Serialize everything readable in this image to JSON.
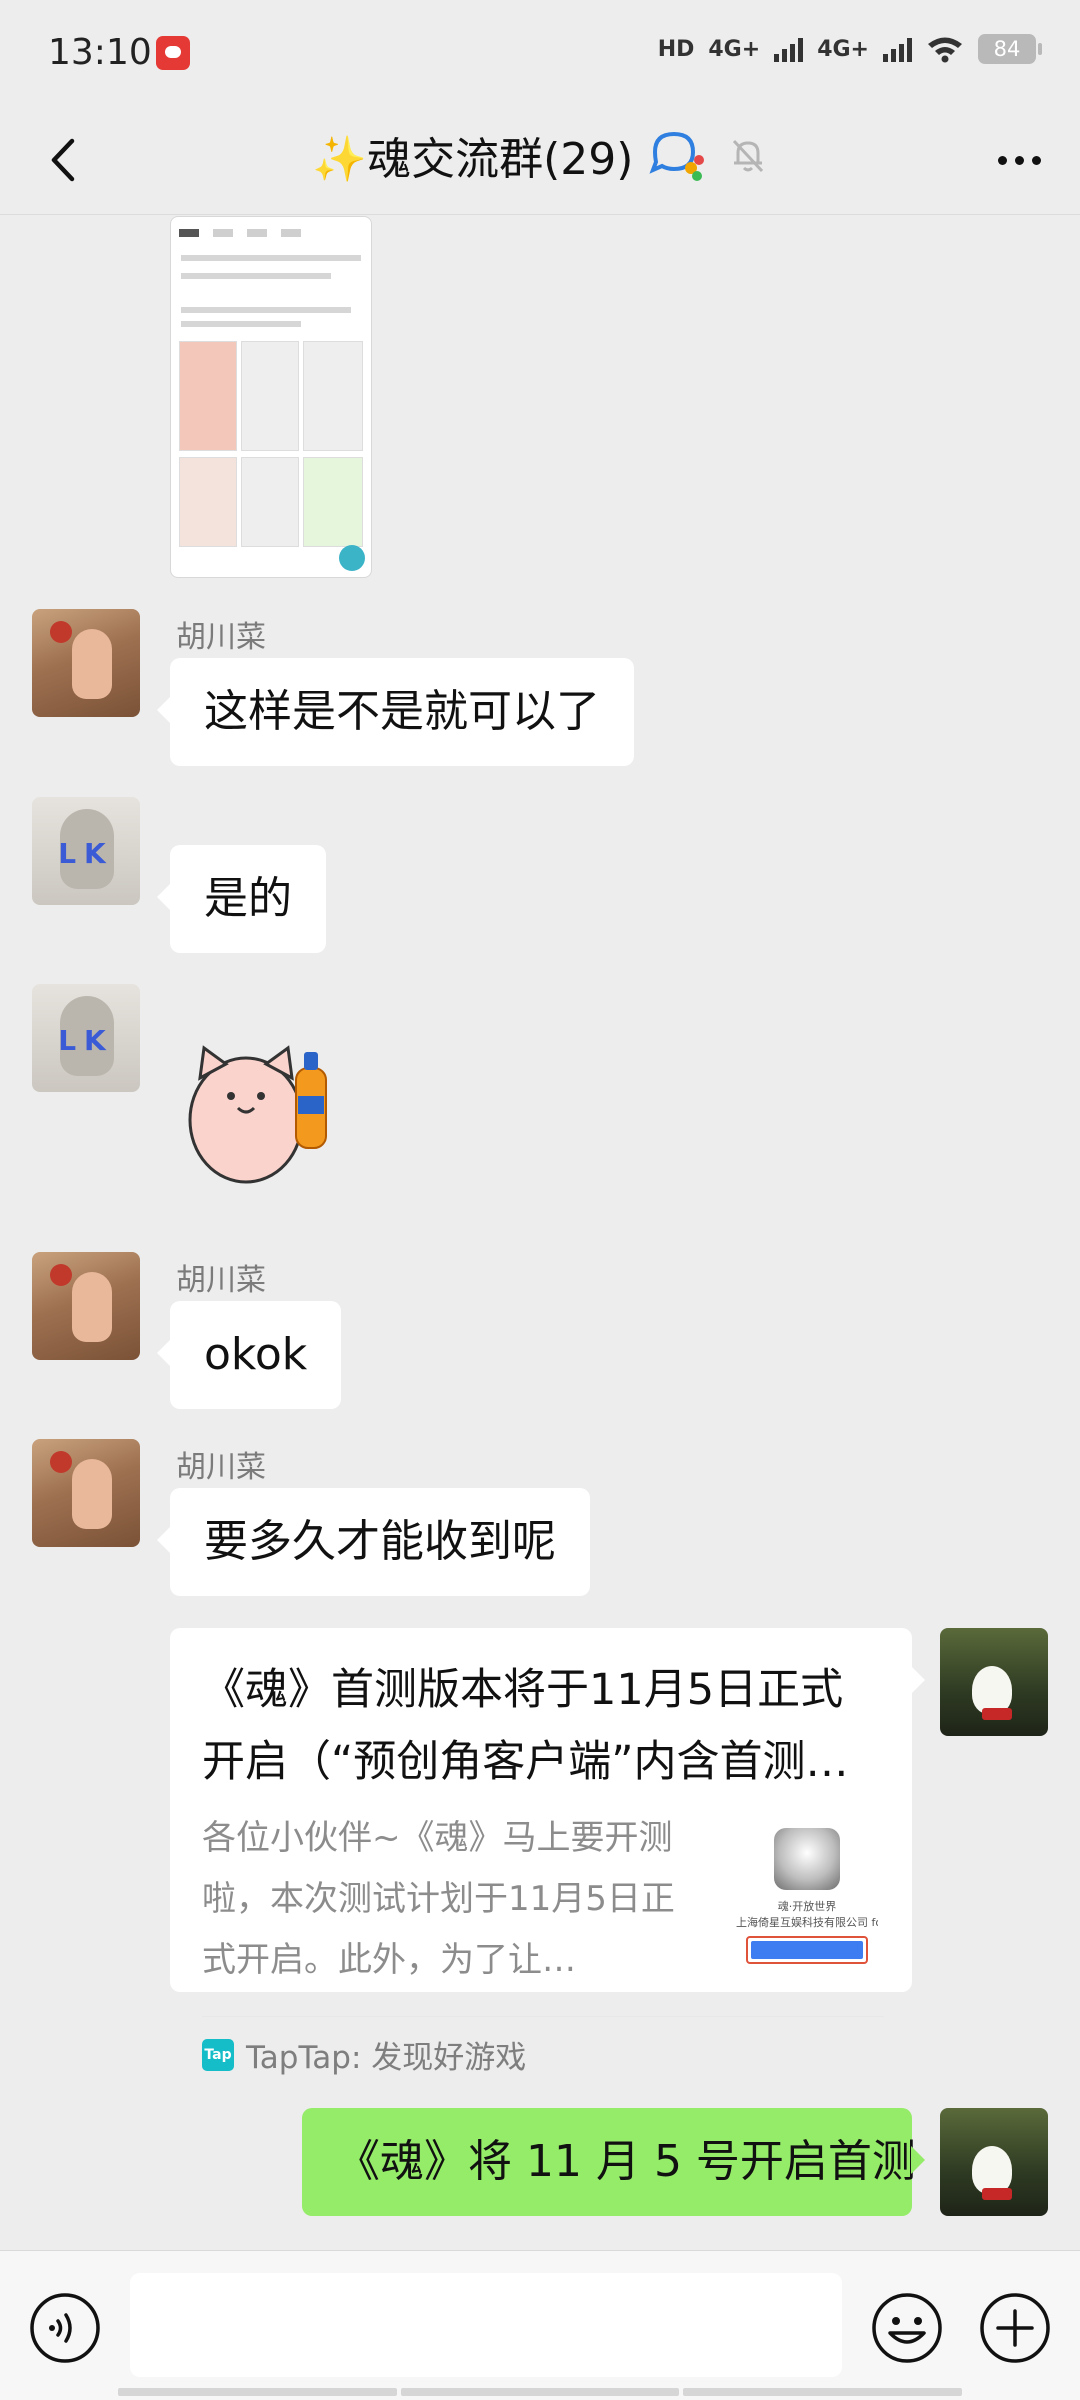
{
  "status_bar": {
    "time": "13:10",
    "hd_tag": "HD",
    "network_1": "4G+",
    "network_2": "4G+",
    "battery": "84"
  },
  "header": {
    "title": "✨魂交流群(29)",
    "icons": [
      "back-arrow-icon",
      "group-chat-icon",
      "muted-bell-icon",
      "more-icon"
    ]
  },
  "messages": [
    {
      "type": "image",
      "direction": "in"
    },
    {
      "type": "text",
      "direction": "in",
      "sender": "胡川菜",
      "text": "这样是不是就可以了",
      "avatar": "pig"
    },
    {
      "type": "text",
      "direction": "in",
      "sender": "",
      "text": "是的",
      "avatar": "look"
    },
    {
      "type": "sticker",
      "direction": "in",
      "sender": "",
      "avatar": "look"
    },
    {
      "type": "text",
      "direction": "in",
      "sender": "胡川菜",
      "text": "okok",
      "avatar": "pig"
    },
    {
      "type": "text",
      "direction": "in",
      "sender": "胡川菜",
      "text": "要多久才能收到呢",
      "avatar": "pig"
    },
    {
      "type": "link_card",
      "direction": "out",
      "title": "《魂》首测版本将于11月5日正式开启（“预创角客户端”内含首测…",
      "description": "各位小伙伴~《魂》马上要开测啦，本次测试计划于11月5日正式开启。此外，为了让…",
      "thumb_name": "魂·开放世界",
      "thumb_company": "上海倚星互娱科技有限公司 for i",
      "source": "TapTap: 发现好游戏",
      "source_icon": "Tap"
    },
    {
      "type": "text",
      "direction": "out",
      "text": "《魂》将 11 月 5 号开启首测"
    }
  ],
  "colors": {
    "background": "#ededed",
    "incoming_bubble": "#ffffff",
    "outgoing_bubble": "#95ec69",
    "sender_name": "#7b7b7b",
    "taptap": "#14bdc8"
  },
  "input_bar": {
    "icons": [
      "voice-icon",
      "emoji-icon",
      "plus-icon"
    ],
    "text_value": ""
  }
}
